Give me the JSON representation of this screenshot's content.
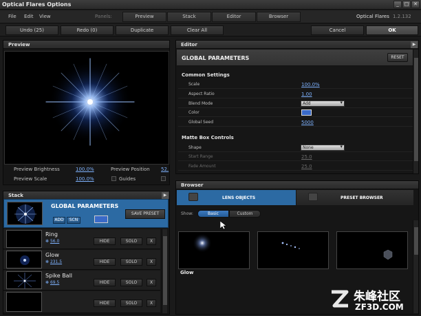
{
  "window": {
    "title": "Optical Flares Options",
    "buttons": [
      "_",
      "□",
      "✕"
    ]
  },
  "menu": {
    "items": [
      "File",
      "Edit",
      "View"
    ],
    "panels_label": "Panels:",
    "panel_tabs": [
      "Preview",
      "Stack",
      "Editor",
      "Browser"
    ],
    "app_name": "Optical Flares",
    "version": "1.2.132"
  },
  "toolbar": {
    "undo": "Undo (25)",
    "redo": "Redo (0)",
    "duplicate": "Duplicate",
    "clear_all": "Clear All",
    "cancel": "Cancel",
    "ok": "OK"
  },
  "preview": {
    "title": "Preview",
    "brightness_label": "Preview Brightness",
    "brightness_value": "100.0%",
    "scale_label": "Preview Scale",
    "scale_value": "100.0%",
    "position_label": "Preview Position",
    "position_value": "52.",
    "guides_label": "Guides"
  },
  "stack": {
    "title": "Stack",
    "global": {
      "title": "GLOBAL PARAMETERS",
      "add": "ADD",
      "scn": "SCN",
      "save_preset": "SAVE PRESET"
    },
    "items": [
      {
        "name": "Ring",
        "value": "56.0",
        "hide": "HIDE",
        "solo": "SOLO",
        "close": "X"
      },
      {
        "name": "Glow",
        "value": "231.5",
        "hide": "HIDE",
        "solo": "SOLO",
        "close": "X"
      },
      {
        "name": "Spike Ball",
        "value": "69.5",
        "hide": "HIDE",
        "solo": "SOLO",
        "close": "X"
      },
      {
        "name": "",
        "value": "",
        "hide": "HIDE",
        "solo": "SOLO",
        "close": "X"
      }
    ]
  },
  "editor": {
    "title": "Editor",
    "header": "GLOBAL PARAMETERS",
    "reset": "RESET",
    "common_title": "Common Settings",
    "scale_label": "Scale",
    "scale_value": "100.0%",
    "aspect_label": "Aspect Ratio",
    "aspect_value": "1.00",
    "blend_label": "Blend Mode",
    "blend_value": "Add",
    "color_label": "Color",
    "color_value": "#3a6ac8",
    "seed_label": "Global Seed",
    "seed_value": "5000",
    "matte_title": "Matte Box Controls",
    "shape_label": "Shape",
    "shape_value": "None",
    "start_label": "Start Range",
    "start_value": "25.0",
    "fade_label": "Fade Amount",
    "fade_value": "25.0"
  },
  "browser": {
    "title": "Browser",
    "tab_lens": "LENS OBJECTS",
    "tab_preset": "PRESET BROWSER",
    "show_label": "Show:",
    "basic": "Basic",
    "custom": "Custom",
    "first_item": "Glow"
  },
  "colors": {
    "accent": "#2c6aa3",
    "link": "#7fb3ff",
    "panel": "#161616"
  },
  "watermark": {
    "cn": "朱峰社区",
    "url": "ZF3D.COM"
  }
}
